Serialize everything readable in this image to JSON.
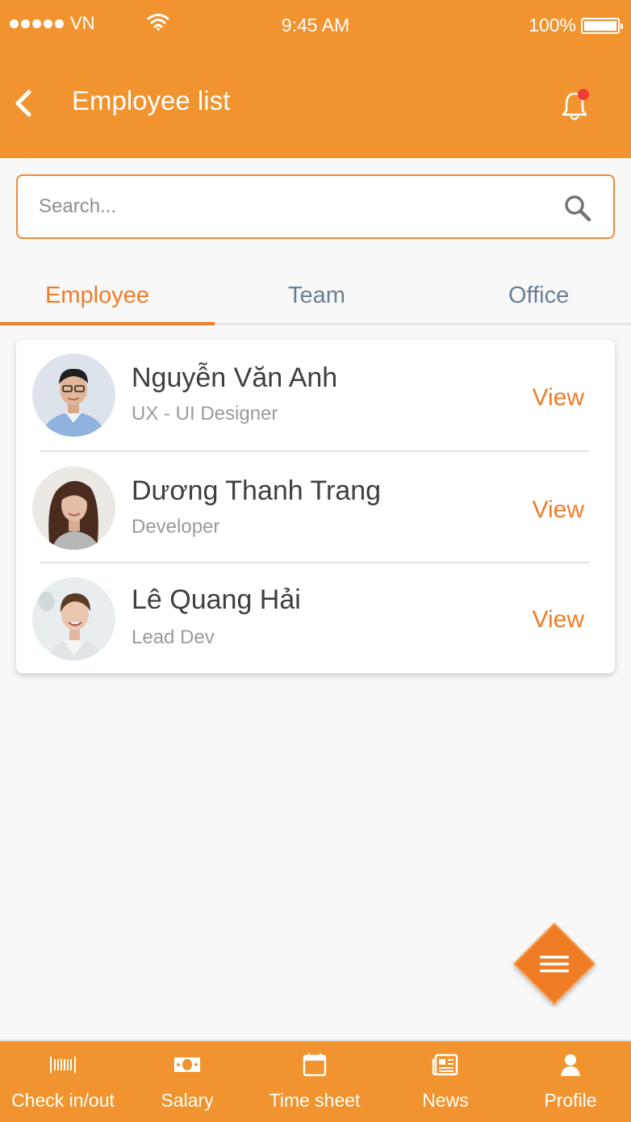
{
  "status_bar": {
    "carrier": "VN",
    "time": "9:45 AM",
    "battery": "100%"
  },
  "header": {
    "title": "Employee list",
    "back_icon": "chevron-left-icon",
    "notification_icon": "bell-icon",
    "notification_badge_color": "#f23b3b"
  },
  "search": {
    "placeholder": "Search...",
    "value": "",
    "icon": "search-icon"
  },
  "tabs": [
    {
      "label": "Employee",
      "active": true
    },
    {
      "label": "Team",
      "active": false
    },
    {
      "label": "Office",
      "active": false
    }
  ],
  "employees": [
    {
      "name": "Nguyễn Văn Anh",
      "role": "UX - UI Designer",
      "action": "View"
    },
    {
      "name": "Dương Thanh Trang",
      "role": "Developer",
      "action": "View"
    },
    {
      "name": "Lê Quang Hải",
      "role": "Lead Dev",
      "action": "View"
    }
  ],
  "fab": {
    "icon": "menu-icon"
  },
  "bottom_nav": [
    {
      "label": "Check in/out",
      "icon": "barcode-icon"
    },
    {
      "label": "Salary",
      "icon": "money-icon"
    },
    {
      "label": "Time sheet",
      "icon": "calendar-icon"
    },
    {
      "label": "News",
      "icon": "newspaper-icon"
    },
    {
      "label": "Profile",
      "icon": "user-icon"
    }
  ],
  "colors": {
    "brand_orange": "#f19430",
    "accent_orange": "#f07c25",
    "tab_inactive": "#6a7f92",
    "background": "#f8f8f8"
  }
}
